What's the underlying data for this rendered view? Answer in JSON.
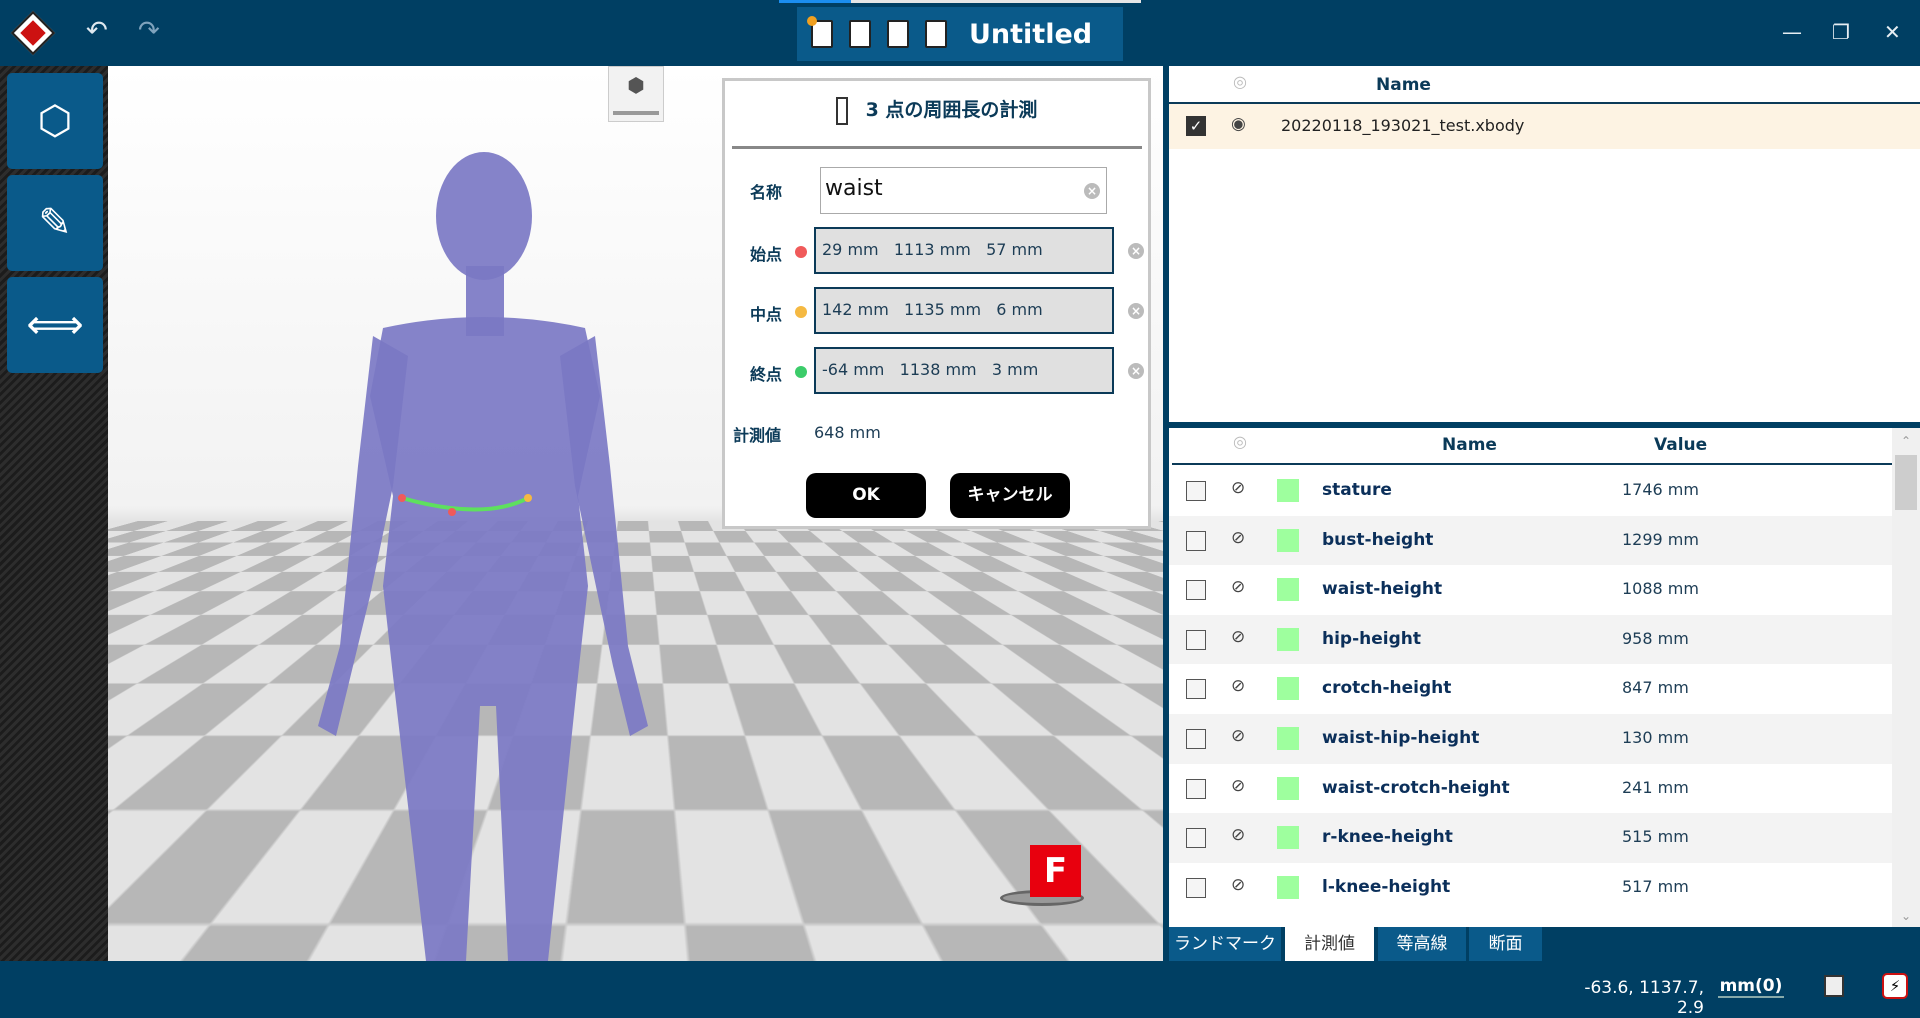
{
  "titlebar": {
    "title": "Untitled",
    "icons": [
      "app-logo",
      "undo-icon",
      "redo-icon",
      "new-file-icon",
      "open-file-icon",
      "save-icon",
      "save-as-icon"
    ],
    "window_controls": [
      "minimize",
      "restore",
      "close"
    ]
  },
  "left_toolbar": {
    "buttons": [
      "shapes-icon",
      "pencil-ruler-icon",
      "arrows-horizontal-icon"
    ]
  },
  "viewport": {
    "orientation_marker": "F"
  },
  "dialog": {
    "title": "3 点の周囲長の計測",
    "name_label": "名称",
    "name_value": "waist",
    "points": [
      {
        "label": "始点",
        "value": "29 mm   1113 mm   57 mm",
        "color": "#f05a5a"
      },
      {
        "label": "中点",
        "value": "142 mm   1135 mm   6 mm",
        "color": "#f5b942"
      },
      {
        "label": "終点",
        "value": "-64 mm   1138 mm   3 mm",
        "color": "#3ccc6a"
      }
    ],
    "result_label": "計測値",
    "result_value": "648 mm",
    "ok": "OK",
    "cancel": "キャンセル"
  },
  "files": {
    "header_name": "Name",
    "rows": [
      {
        "name": "20220118_193021_test.xbody",
        "checked": true,
        "visible": true
      }
    ]
  },
  "measurements": {
    "header_name": "Name",
    "header_value": "Value",
    "swatch_color": "#9eff9e",
    "rows": [
      {
        "name": "stature",
        "value": "1746 mm"
      },
      {
        "name": "bust-height",
        "value": "1299 mm"
      },
      {
        "name": "waist-height",
        "value": "1088 mm"
      },
      {
        "name": "hip-height",
        "value": "958 mm"
      },
      {
        "name": "crotch-height",
        "value": "847 mm"
      },
      {
        "name": "waist-hip-height",
        "value": "130 mm"
      },
      {
        "name": "waist-crotch-height",
        "value": "241 mm"
      },
      {
        "name": "r-knee-height",
        "value": "515 mm"
      },
      {
        "name": "l-knee-height",
        "value": "517 mm"
      }
    ]
  },
  "tabs": [
    {
      "label": "ランドマーク"
    },
    {
      "label": "計測値",
      "active": true
    },
    {
      "label": "等高線"
    },
    {
      "label": "断面"
    }
  ],
  "status": {
    "coords": "-63.6, 1137.7, 2.9",
    "unit": "mm(0)"
  }
}
